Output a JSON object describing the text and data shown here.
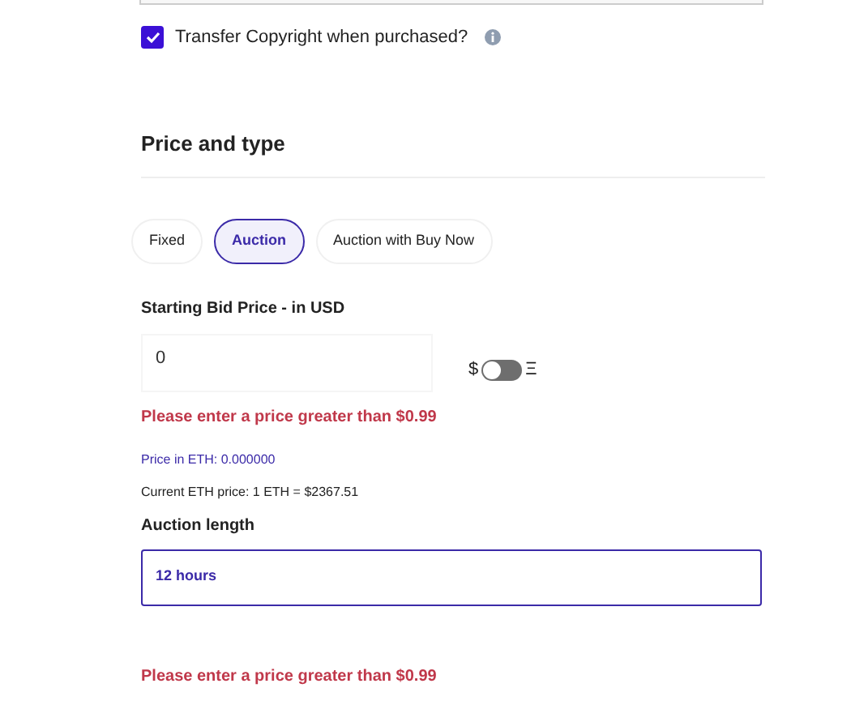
{
  "copyright": {
    "label": "Transfer Copyright when purchased?",
    "checked": true
  },
  "section": {
    "title": "Price and type"
  },
  "tabs": [
    {
      "label": "Fixed",
      "selected": false
    },
    {
      "label": "Auction",
      "selected": true
    },
    {
      "label": "Auction with Buy Now",
      "selected": false
    }
  ],
  "bid": {
    "label": "Starting Bid Price - in USD",
    "value": "0",
    "currency_left": "$",
    "currency_right": "Ξ",
    "eth_mode": false,
    "error": "Please enter a price greater than $0.99"
  },
  "eth_price": "Price in ETH: 0.000000",
  "eth_rate": "Current ETH price: 1 ETH = $2367.51",
  "auction_length": {
    "label": "Auction length",
    "value": "12 hours"
  },
  "bottom_error": "Please enter a price greater than $0.99"
}
